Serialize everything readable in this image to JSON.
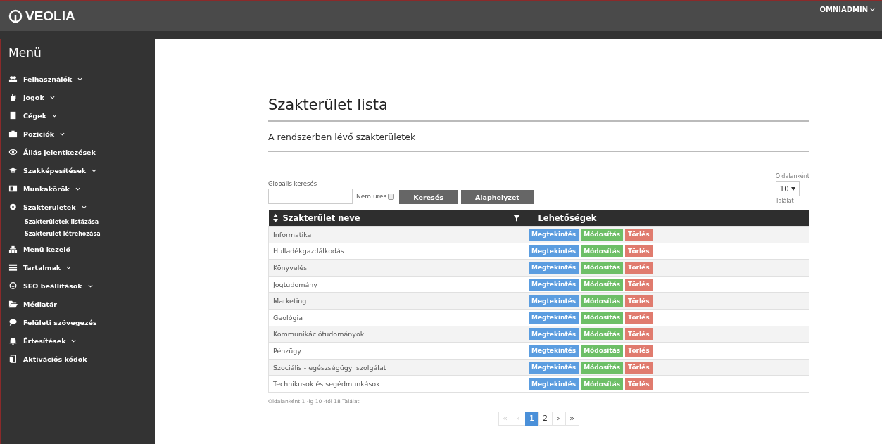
{
  "header": {
    "logo": "VEOLIA",
    "user": "OMNIADMIN"
  },
  "sidebar": {
    "title": "Menü",
    "items": [
      {
        "label": "Felhasználók",
        "kind": "people",
        "expandable": true
      },
      {
        "label": "Jogok",
        "kind": "hand",
        "expandable": true
      },
      {
        "label": "Cégek",
        "kind": "building",
        "expandable": true
      },
      {
        "label": "Pozíciók",
        "kind": "briefcase",
        "expandable": true
      },
      {
        "label": "Állás jelentkezések",
        "kind": "eye",
        "expandable": false
      },
      {
        "label": "Szakképesítések",
        "kind": "cap",
        "expandable": true
      },
      {
        "label": "Munkakörök",
        "kind": "card",
        "expandable": true
      },
      {
        "label": "Szakterületek",
        "kind": "disc",
        "expandable": true,
        "children": [
          {
            "label": "Szakterületek listázása"
          },
          {
            "label": "Szakterület létrehozása"
          }
        ]
      },
      {
        "label": "Menü kezelő",
        "kind": "sitemap",
        "expandable": false
      },
      {
        "label": "Tartalmak",
        "kind": "list",
        "expandable": true
      },
      {
        "label": "SEO beállítások",
        "kind": "smiley",
        "expandable": true
      },
      {
        "label": "Médiatár",
        "kind": "folder",
        "expandable": false
      },
      {
        "label": "Felületi szövegezés",
        "kind": "chat",
        "expandable": false
      },
      {
        "label": "Értesítések",
        "kind": "bell",
        "expandable": true
      },
      {
        "label": "Aktivációs kódok",
        "kind": "door",
        "expandable": false
      }
    ]
  },
  "page": {
    "title": "Szakterület lista",
    "subtitle": "A rendszerben lévő szakterületek"
  },
  "search": {
    "label": "Globális keresés",
    "not_empty_label": "Nem üres",
    "not_empty_checked": false,
    "buttons": [
      "Keresés",
      "Alaphelyzet"
    ]
  },
  "page_size": {
    "label": "Oldalanként",
    "value": "10",
    "caption": "Találat"
  },
  "table": {
    "columns": [
      "Szakterület neve",
      "Lehetőségek"
    ],
    "rows": [
      {
        "name": "Informatika",
        "actions": [
          "Megtekintés",
          "Módosítás",
          "Törlés"
        ]
      },
      {
        "name": "Hulladékgazdálkodás",
        "actions": [
          "Megtekintés",
          "Módosítás",
          "Törlés"
        ]
      },
      {
        "name": "Könyvelés",
        "actions": [
          "Megtekintés",
          "Módosítás",
          "Törlés"
        ]
      },
      {
        "name": "Jogtudomány",
        "actions": [
          "Megtekintés",
          "Módosítás",
          "Törlés"
        ]
      },
      {
        "name": "Marketing",
        "actions": [
          "Megtekintés",
          "Módosítás",
          "Törlés"
        ]
      },
      {
        "name": "Geológia",
        "actions": [
          "Megtekintés",
          "Módosítás",
          "Törlés"
        ]
      },
      {
        "name": "Kommunikációtudományok",
        "actions": [
          "Megtekintés",
          "Módosítás",
          "Törlés"
        ]
      },
      {
        "name": "Pénzügy",
        "actions": [
          "Megtekintés",
          "Módosítás",
          "Törlés"
        ]
      },
      {
        "name": "Szociális - egészségügyi szolgálat",
        "actions": [
          "Megtekintés",
          "Módosítás",
          "Törlés"
        ]
      },
      {
        "name": "Technikusok és segédmunkások",
        "actions": [
          "Megtekintés",
          "Módosítás",
          "Törlés"
        ]
      }
    ]
  },
  "summary": "Oldalanként 1 -ig 10 -től 18 Találat",
  "pagination": [
    {
      "label": "«",
      "selected": false,
      "disabled": true
    },
    {
      "label": "‹",
      "selected": false,
      "disabled": true
    },
    {
      "label": "1",
      "selected": true,
      "disabled": false
    },
    {
      "label": "2",
      "selected": false,
      "disabled": false
    },
    {
      "label": "›",
      "selected": false,
      "disabled": false
    },
    {
      "label": "»",
      "selected": false,
      "disabled": false
    }
  ]
}
